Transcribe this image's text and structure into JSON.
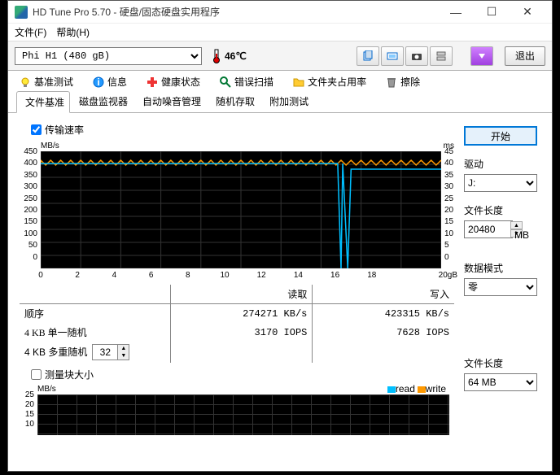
{
  "window": {
    "title": "HD Tune Pro 5.70  - 硬盘/固态硬盘实用程序"
  },
  "menu": {
    "file": "文件(F)",
    "help": "帮助(H)"
  },
  "toolbar": {
    "drive": "Phi   H1 (480 gB)",
    "temp": "46℃",
    "exit": "退出"
  },
  "tabs1": {
    "a": "基准测试",
    "b": "信息",
    "c": "健康状态",
    "d": "错误扫描",
    "e": "文件夹占用率",
    "f": "擦除"
  },
  "tabs2": {
    "a": "文件基准",
    "b": "磁盘监视器",
    "c": "自动噪音管理",
    "d": "随机存取",
    "e": "附加测试"
  },
  "chk_transfer": "传输速率",
  "chart_data": {
    "type": "line",
    "xlabel": "gB",
    "ylabel_left": "MB/s",
    "ylabel_right": "ms",
    "xlim": [
      0,
      20
    ],
    "ylim_left": [
      0,
      450
    ],
    "ylim_right": [
      0,
      45
    ],
    "xticks": [
      0,
      2,
      4,
      6,
      8,
      10,
      12,
      14,
      16,
      18,
      20
    ],
    "yticks_left": [
      0,
      50,
      100,
      150,
      200,
      250,
      300,
      350,
      400,
      450
    ],
    "yticks_right": [
      0,
      5,
      10,
      15,
      20,
      25,
      30,
      35,
      40,
      45
    ],
    "series": [
      {
        "name": "read",
        "color": "#00bfff",
        "approx": "~405 MB/s flat, dip to ~0 near x≈15, recovers to ~380"
      },
      {
        "name": "write",
        "color": "#ff9900",
        "approx": "oscillating 395–415 MB/s across full range"
      }
    ]
  },
  "results": {
    "col_read": "读取",
    "col_write": "写入",
    "rows": [
      {
        "label": "顺序",
        "read": "274271 KB/s",
        "write": "423315 KB/s"
      },
      {
        "label": "4 KB 单一随机",
        "read": "3170 IOPS",
        "write": "7628 IOPS"
      },
      {
        "label": "4 KB 多重随机",
        "read": "",
        "write": ""
      }
    ],
    "multi_random_value": "32"
  },
  "blocksize": {
    "label": "测量块大小",
    "ylabel": "MB/s",
    "yticks": [
      10,
      15,
      20,
      25
    ],
    "legend": {
      "read": "read",
      "write": "write"
    }
  },
  "side": {
    "start": "开始",
    "drive_label": "驱动",
    "drive_value": "J:",
    "filelen_label": "文件长度",
    "filelen_value": "20480",
    "filelen_unit": "MB",
    "datamode_label": "数据模式",
    "datamode_value": "零",
    "filelen2_label": "文件长度",
    "filelen2_value": "64 MB"
  }
}
